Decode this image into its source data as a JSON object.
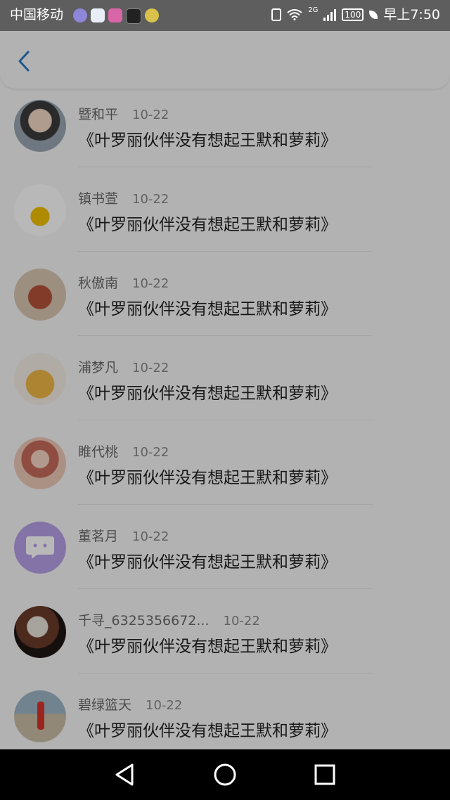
{
  "status_bar": {
    "carrier": "中国移动",
    "network": "2G",
    "battery": "100",
    "time": "早上7:50",
    "app_icons": [
      "browser-icon",
      "video-icon",
      "music-icon",
      "tiktok-icon",
      "wifi-app-icon"
    ]
  },
  "header": {
    "back_icon": "back-arrow-icon"
  },
  "comments": [
    {
      "name": "暨和平",
      "date": "10-22",
      "title": "《叶罗丽伙伴没有想起王默和萝莉》"
    },
    {
      "name": "镇书萱",
      "date": "10-22",
      "title": "《叶罗丽伙伴没有想起王默和萝莉》"
    },
    {
      "name": "秋傲南",
      "date": "10-22",
      "title": "《叶罗丽伙伴没有想起王默和萝莉》"
    },
    {
      "name": "浦梦凡",
      "date": "10-22",
      "title": "《叶罗丽伙伴没有想起王默和萝莉》"
    },
    {
      "name": "睢代桃",
      "date": "10-22",
      "title": "《叶罗丽伙伴没有想起王默和萝莉》"
    },
    {
      "name": "董茗月",
      "date": "10-22",
      "title": "《叶罗丽伙伴没有想起王默和萝莉》"
    },
    {
      "name": "千寻_6325356672...",
      "date": "10-22",
      "title": "《叶罗丽伙伴没有想起王默和萝莉》"
    },
    {
      "name": "碧绿篮天",
      "date": "10-22",
      "title": "《叶罗丽伙伴没有想起王默和萝莉》"
    }
  ],
  "nav": {
    "back": "nav-back-icon",
    "home": "nav-home-icon",
    "recent": "nav-recent-icon"
  },
  "colors": {
    "accent": "#2a79c2",
    "status_bar": "#5e5e5e",
    "nav_bar": "#000000"
  }
}
